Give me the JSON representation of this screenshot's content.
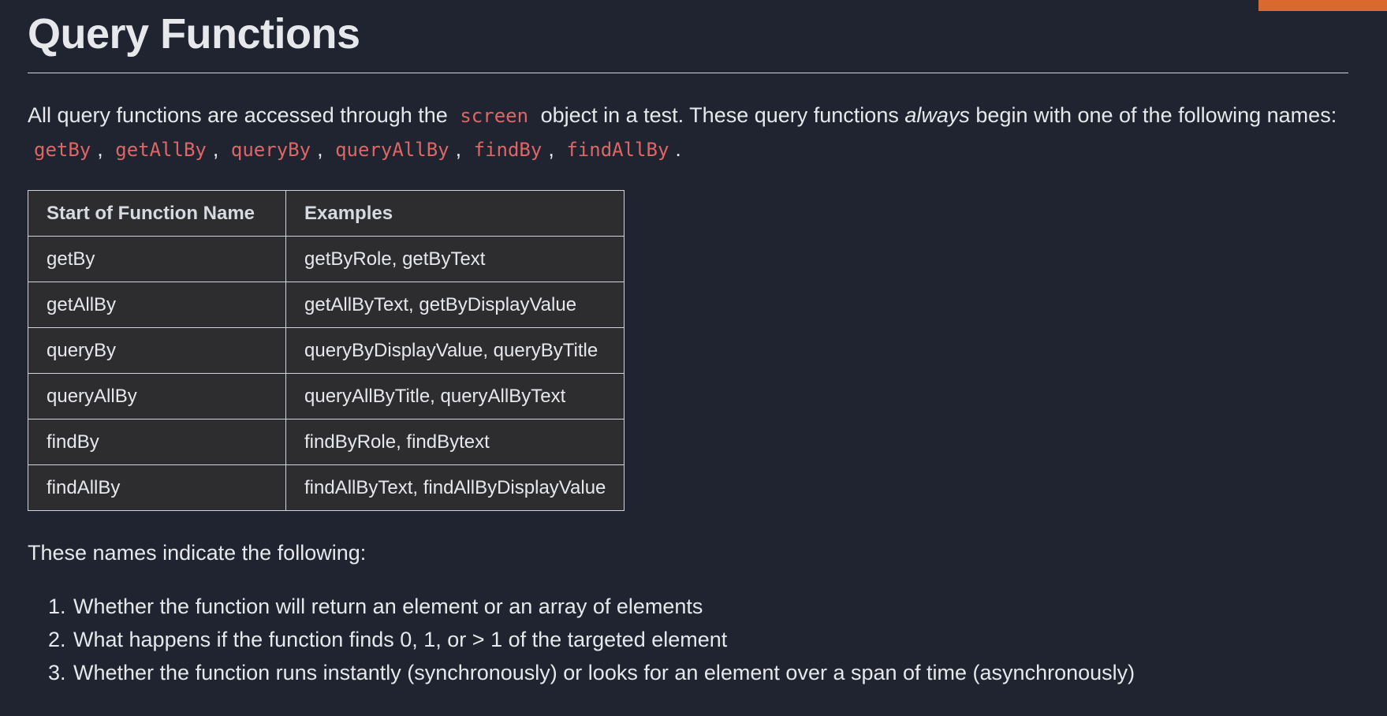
{
  "accent_color": "#d9692d",
  "code_color": "#e06666",
  "title": "Query Functions",
  "intro": {
    "text_before_code": "All query functions are accessed through the",
    "code_screen": "screen",
    "text_after_code": "object in a test. These query functions",
    "emphasis": "always",
    "text_after_emphasis": "begin with one of the following names:",
    "names": [
      "getBy",
      "getAllBy",
      "queryBy",
      "queryAllBy",
      "findBy",
      "findAllBy"
    ],
    "separator": ",",
    "terminator": "."
  },
  "table": {
    "headers": [
      "Start of Function Name",
      "Examples"
    ],
    "rows": [
      [
        "getBy",
        "getByRole, getByText"
      ],
      [
        "getAllBy",
        "getAllByText, getByDisplayValue"
      ],
      [
        "queryBy",
        "queryByDisplayValue, queryByTitle"
      ],
      [
        "queryAllBy",
        "queryAllByTitle, queryAllByText"
      ],
      [
        "findBy",
        "findByRole, findBytext"
      ],
      [
        "findAllBy",
        "findAllByText, findAllByDisplayValue"
      ]
    ]
  },
  "after_table_text": "These names indicate the following:",
  "list_items": [
    "Whether the function will return an element or an array of elements",
    "What happens if the function finds 0, 1, or > 1 of the targeted element",
    "Whether the function runs instantly (synchronously) or looks for an element over a span of time (asynchronously)"
  ]
}
